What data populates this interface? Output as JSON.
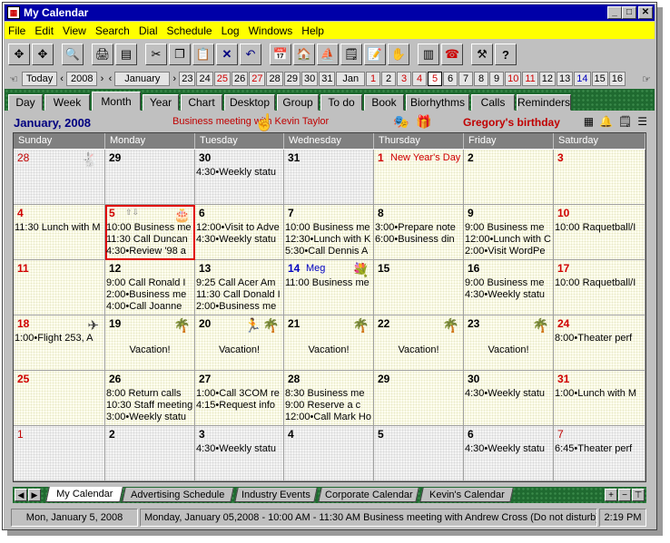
{
  "window": {
    "title": "My Calendar"
  },
  "menu": [
    "File",
    "Edit",
    "View",
    "Search",
    "Dial",
    "Schedule",
    "Log",
    "Windows",
    "Help"
  ],
  "datebar": {
    "today_label": "Today",
    "year": "2008",
    "month": "January",
    "dec_days": [
      {
        "d": "23",
        "red": false
      },
      {
        "d": "24",
        "red": false
      },
      {
        "d": "25",
        "red": true
      },
      {
        "d": "26",
        "red": false
      },
      {
        "d": "27",
        "red": true
      },
      {
        "d": "28",
        "red": false
      },
      {
        "d": "29",
        "red": false
      },
      {
        "d": "30",
        "red": false
      },
      {
        "d": "31",
        "red": false
      }
    ],
    "jan_label": "Jan",
    "jan_days": [
      {
        "d": "1",
        "c": "red"
      },
      {
        "d": "2",
        "c": ""
      },
      {
        "d": "3",
        "c": "red"
      },
      {
        "d": "4",
        "c": "red"
      },
      {
        "d": "5",
        "c": "sel"
      },
      {
        "d": "6",
        "c": ""
      },
      {
        "d": "7",
        "c": ""
      },
      {
        "d": "8",
        "c": ""
      },
      {
        "d": "9",
        "c": ""
      },
      {
        "d": "10",
        "c": "red"
      },
      {
        "d": "11",
        "c": "red"
      },
      {
        "d": "12",
        "c": ""
      },
      {
        "d": "13",
        "c": ""
      },
      {
        "d": "14",
        "c": "blue"
      },
      {
        "d": "15",
        "c": ""
      },
      {
        "d": "16",
        "c": ""
      }
    ]
  },
  "view_tabs": [
    "Day",
    "Week",
    "Month",
    "Year",
    "Chart",
    "Desktop",
    "Group",
    "To do",
    "Book",
    "Biorhythms",
    "Calls",
    "Reminders"
  ],
  "active_view": "Month",
  "header": {
    "month_title": "January, 2008",
    "current_event": "Business meeting with Kevin Taylor",
    "birthday": "Gregory's birthday"
  },
  "day_names": [
    "Sunday",
    "Monday",
    "Tuesday",
    "Wednesday",
    "Thursday",
    "Friday",
    "Saturday"
  ],
  "weeks": [
    [
      {
        "d": "28",
        "c": "gray",
        "other": true,
        "icon": "rabbit-icon",
        "ev": []
      },
      {
        "d": "29",
        "c": "",
        "other": true,
        "ev": []
      },
      {
        "d": "30",
        "c": "",
        "other": true,
        "ev": [
          "4:30•Weekly statu"
        ]
      },
      {
        "d": "31",
        "c": "",
        "other": true,
        "ev": []
      },
      {
        "d": "1",
        "c": "red",
        "label": "New Year's Day",
        "ev": []
      },
      {
        "d": "2",
        "c": "",
        "ev": []
      },
      {
        "d": "3",
        "c": "red",
        "ev": []
      }
    ],
    [
      {
        "d": "4",
        "c": "red",
        "ev": [
          "11:30  Lunch with M"
        ]
      },
      {
        "d": "5",
        "c": "red",
        "today": true,
        "icon": "cake-icon",
        "ev": [
          "10:00  Business me",
          "11:30  Call Duncan",
          "4:30•Review '98 a"
        ]
      },
      {
        "d": "6",
        "c": "",
        "ev": [
          "12:00•Visit to Adve",
          "4:30•Weekly statu"
        ]
      },
      {
        "d": "7",
        "c": "",
        "ev": [
          "10:00  Business me",
          "12:30•Lunch with K",
          "5:30•Call Dennis A"
        ]
      },
      {
        "d": "8",
        "c": "",
        "ev": [
          "3:00•Prepare note",
          "6:00•Business din"
        ]
      },
      {
        "d": "9",
        "c": "",
        "ev": [
          "9:00  Business me",
          "12:00•Lunch with C",
          "2:00•Visit WordPe"
        ]
      },
      {
        "d": "10",
        "c": "red",
        "ev": [
          "10:00  Raquetball/I"
        ]
      }
    ],
    [
      {
        "d": "11",
        "c": "red",
        "ev": []
      },
      {
        "d": "12",
        "c": "",
        "ev": [
          "9:00  Call Ronald I",
          "2:00•Business me",
          "4:00•Call Joanne"
        ]
      },
      {
        "d": "13",
        "c": "",
        "ev": [
          "9:25  Call Acer Am",
          "11:30  Call Donald I",
          "2:00•Business me"
        ]
      },
      {
        "d": "14",
        "c": "blue",
        "label": "Meg",
        "icon": "flowers-icon",
        "ev": [
          "11:00  Business me"
        ]
      },
      {
        "d": "15",
        "c": "",
        "ev": []
      },
      {
        "d": "16",
        "c": "",
        "ev": [
          "9:00  Business me",
          "4:30•Weekly statu"
        ]
      },
      {
        "d": "17",
        "c": "red",
        "ev": [
          "10:00  Raquetball/I"
        ]
      }
    ],
    [
      {
        "d": "18",
        "c": "red",
        "icon": "plane-icon",
        "ev": [
          "1:00•Flight 253, A"
        ]
      },
      {
        "d": "19",
        "c": "",
        "icon": "palm-icon",
        "vac": "Vacation!",
        "ev": []
      },
      {
        "d": "20",
        "c": "",
        "icon": "palm-icon",
        "vac": "Vacation!",
        "ev": []
      },
      {
        "d": "21",
        "c": "",
        "icon": "palm-icon",
        "vac": "Vacation!",
        "ev": []
      },
      {
        "d": "22",
        "c": "",
        "icon": "palm-icon",
        "vac": "Vacation!",
        "ev": []
      },
      {
        "d": "23",
        "c": "",
        "icon": "palm-icon",
        "vac": "Vacation!",
        "ev": []
      },
      {
        "d": "24",
        "c": "red",
        "ev": [
          "8:00•Theater perf"
        ]
      }
    ],
    [
      {
        "d": "25",
        "c": "red",
        "ev": []
      },
      {
        "d": "26",
        "c": "",
        "ev": [
          "8:00  Return calls",
          "10:30  Staff meeting",
          "3:00•Weekly statu"
        ]
      },
      {
        "d": "27",
        "c": "",
        "ev": [
          "1:00•Call 3COM re",
          "4:15•Request info"
        ]
      },
      {
        "d": "28",
        "c": "",
        "ev": [
          "8:30  Business me",
          "9:00  Reserve a c",
          "12:00•Call Mark Ho"
        ]
      },
      {
        "d": "29",
        "c": "",
        "ev": []
      },
      {
        "d": "30",
        "c": "",
        "ev": [
          "4:30•Weekly statu"
        ]
      },
      {
        "d": "31",
        "c": "red",
        "ev": [
          "1:00•Lunch with M"
        ]
      }
    ],
    [
      {
        "d": "1",
        "c": "gray",
        "other": true,
        "ev": []
      },
      {
        "d": "2",
        "c": "",
        "other": true,
        "ev": []
      },
      {
        "d": "3",
        "c": "",
        "other": true,
        "ev": [
          "4:30•Weekly statu"
        ]
      },
      {
        "d": "4",
        "c": "",
        "other": true,
        "ev": []
      },
      {
        "d": "5",
        "c": "",
        "other": true,
        "ev": []
      },
      {
        "d": "6",
        "c": "",
        "other": true,
        "ev": [
          "4:30•Weekly statu"
        ]
      },
      {
        "d": "7",
        "c": "gray",
        "other": true,
        "ev": [
          "6:45•Theater perf"
        ]
      }
    ]
  ],
  "calendar_tabs": [
    "My Calendar",
    "Advertising Schedule",
    "Industry Events",
    "Corporate Calendar",
    "Kevin's Calendar"
  ],
  "status": {
    "date": "Mon, January 5, 2008",
    "event": "Monday, January 05,2008 - 10:00 AM - 11:30 AM     Business meeting with Andrew Cross (Do not disturb)",
    "time": "2:19 PM"
  },
  "colors": {
    "title_bg": "#0000a8",
    "menu_bg": "#ffff00",
    "month_title": "#000080",
    "red_text": "#c00000"
  }
}
